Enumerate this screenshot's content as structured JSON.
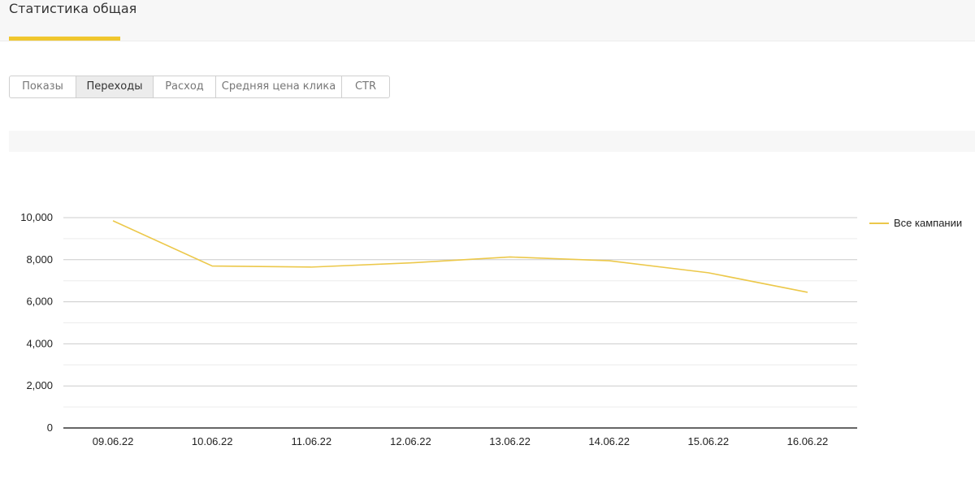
{
  "header": {
    "title": "Статистика общая"
  },
  "tabs": [
    {
      "label": "Показы",
      "active": false
    },
    {
      "label": "Переходы",
      "active": true
    },
    {
      "label": "Расход",
      "active": false
    },
    {
      "label": "Средняя цена клика",
      "active": false
    },
    {
      "label": "CTR",
      "active": false
    }
  ],
  "colors": {
    "accent": "#f0c72e",
    "series": "#ecc84a",
    "grid": "#cccccc",
    "axis": "#333333"
  },
  "chart_data": {
    "type": "line",
    "x": [
      "09.06.22",
      "10.06.22",
      "11.06.22",
      "12.06.22",
      "13.06.22",
      "14.06.22",
      "15.06.22",
      "16.06.22"
    ],
    "series": [
      {
        "name": "Все кампании",
        "values": [
          9850,
          7700,
          7650,
          7850,
          8130,
          7950,
          7380,
          6450
        ]
      }
    ],
    "y_ticks": [
      "10,000",
      "8,000",
      "6,000",
      "4,000",
      "2,000",
      "0"
    ],
    "ylim": [
      0,
      10000
    ],
    "grid": true,
    "legend": "right"
  }
}
